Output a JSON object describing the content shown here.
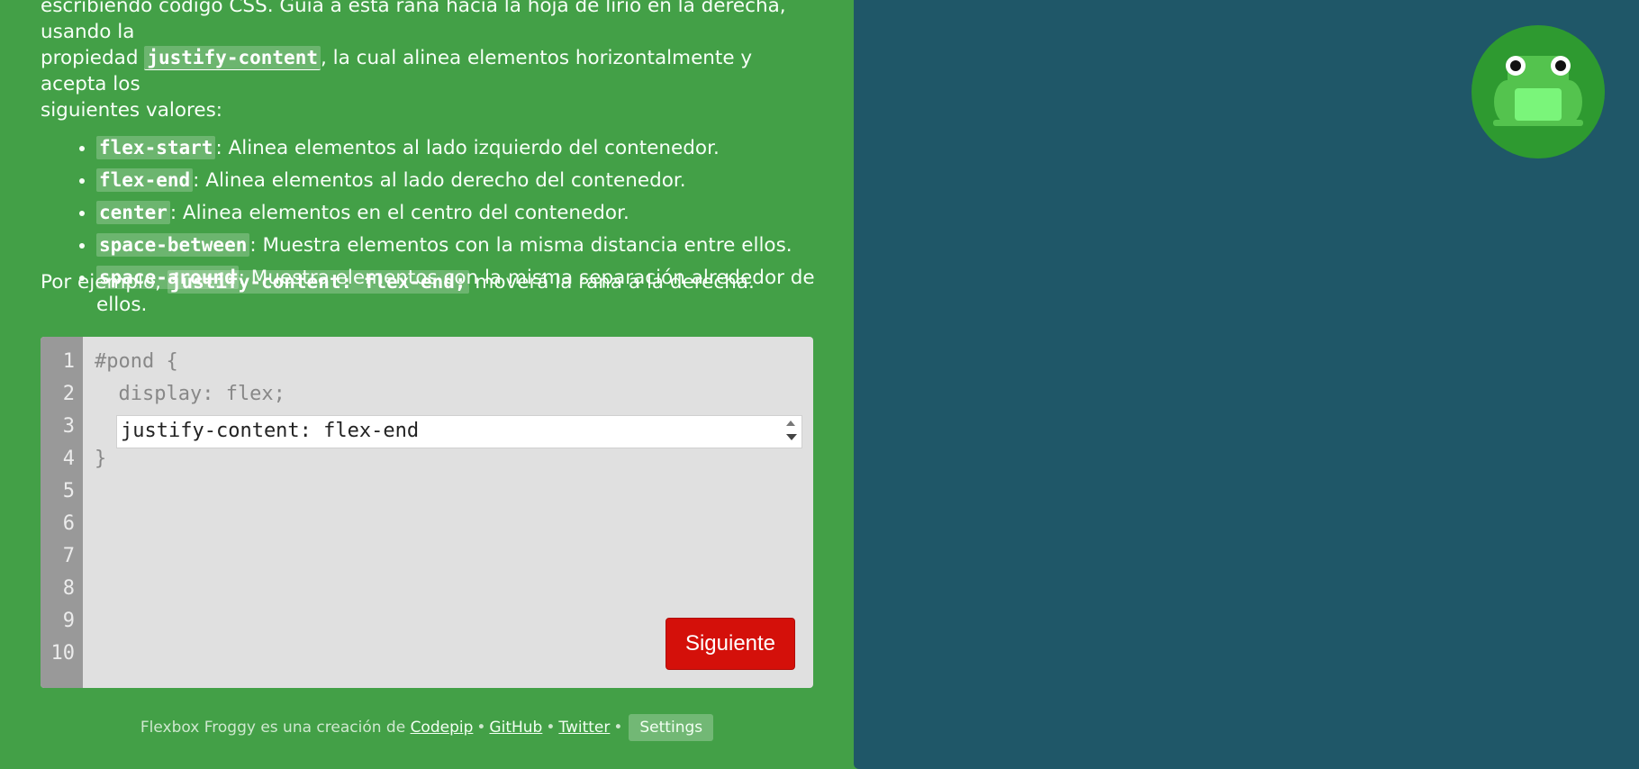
{
  "instructions": {
    "line1": "escribiendo código CSS. Guía a esta rana hacia la hoja de lirio en la derecha, usando la",
    "prop_prefix": "propiedad ",
    "prop_code": "justify-content",
    "prop_suffix": ", la cual alinea elementos horizontalmente y acepta los",
    "line3": "siguientes valores:",
    "values": [
      {
        "code": "flex-start",
        "desc": ": Alinea elementos al lado izquierdo del contenedor."
      },
      {
        "code": "flex-end",
        "desc": ": Alinea elementos al lado derecho del contenedor."
      },
      {
        "code": "center",
        "desc": ": Alinea elementos en el centro del contenedor."
      },
      {
        "code": "space-between",
        "desc": ": Muestra elementos con la misma distancia entre ellos."
      },
      {
        "code": "space-around",
        "desc": ": Muestra elementos con la misma separación alrededor de ellos."
      }
    ],
    "example_prefix": "Por ejemplo, ",
    "example_code": "justify-content: flex-end;",
    "example_suffix": " moverá la rana a la derecha."
  },
  "editor": {
    "line_numbers": [
      "1",
      "2",
      "3",
      "4",
      "5",
      "6",
      "7",
      "8",
      "9",
      "10"
    ],
    "line1": "#pond {",
    "line2": "  display: flex;",
    "input_value": "justify-content: flex-end",
    "line4": "}",
    "next_button": "Siguiente"
  },
  "footer": {
    "credit": "Flexbox Froggy es una creación de ",
    "codepip": "Codepip",
    "github": "GitHub",
    "twitter": "Twitter",
    "settings": "Settings"
  },
  "colors": {
    "sidebar_bg": "#43a047",
    "board_bg": "#1f5768",
    "button_bg": "#d4100a",
    "frog_green": "#6fe06a"
  },
  "board": {
    "frog_icon": "frog-icon",
    "lilypad_icon": "lilypad-icon"
  }
}
